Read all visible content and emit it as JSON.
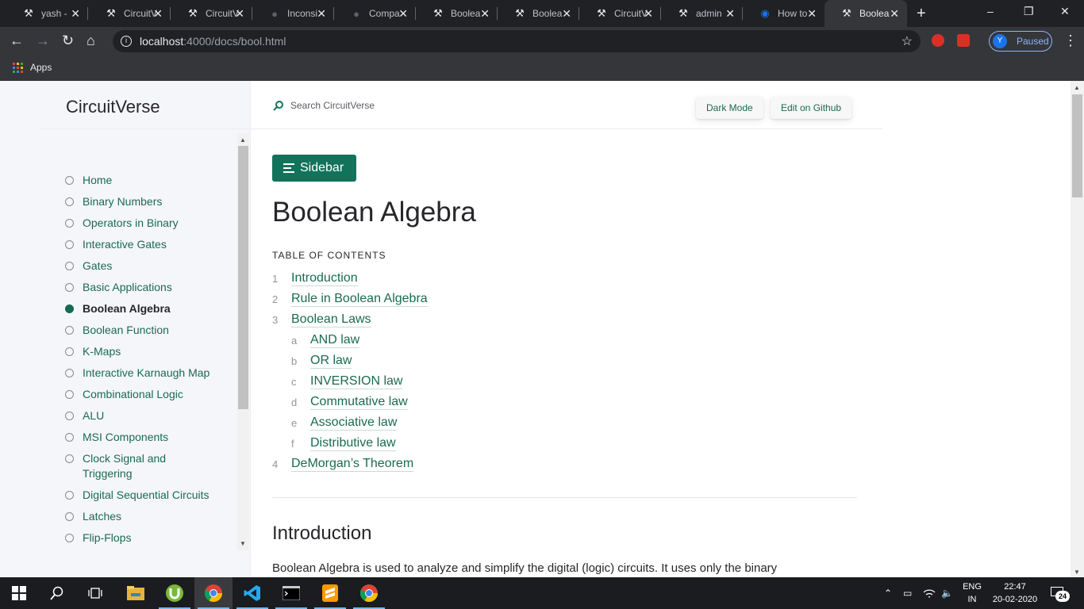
{
  "browser": {
    "tabs": [
      {
        "label": "yash - ",
        "icon": "circuitverse-icon",
        "active": false
      },
      {
        "label": "CircuitV",
        "icon": "circuitverse-icon",
        "active": false
      },
      {
        "label": "CircuitV",
        "icon": "circuitverse-icon",
        "active": false
      },
      {
        "label": "Inconsi",
        "icon": "github-icon",
        "active": false
      },
      {
        "label": "Compa",
        "icon": "github-icon",
        "active": false
      },
      {
        "label": "Boolea",
        "icon": "circuitverse-icon",
        "active": false
      },
      {
        "label": "Boolea",
        "icon": "circuitverse-icon",
        "active": false
      },
      {
        "label": "CircuitV",
        "icon": "circuitverse-icon",
        "active": false
      },
      {
        "label": "admin",
        "icon": "circuitverse-icon",
        "active": false
      },
      {
        "label": "How to",
        "icon": "blue-circle-icon",
        "active": false
      },
      {
        "label": "Boolea",
        "icon": "circuitverse-icon",
        "active": true
      }
    ],
    "url_host": "localhost",
    "url_path": ":4000/docs/bool.html",
    "profile_initial": "Y",
    "profile_status": "Paused",
    "bookmarks": {
      "apps_label": "Apps"
    }
  },
  "sidebar": {
    "brand": "CircuitVerse",
    "items": [
      {
        "label": "Home",
        "active": false
      },
      {
        "label": "Binary Numbers",
        "active": false
      },
      {
        "label": "Operators in Binary",
        "active": false
      },
      {
        "label": "Interactive Gates",
        "active": false
      },
      {
        "label": "Gates",
        "active": false
      },
      {
        "label": "Basic Applications",
        "active": false
      },
      {
        "label": "Boolean Algebra",
        "active": true
      },
      {
        "label": "Boolean Function",
        "active": false
      },
      {
        "label": "K-Maps",
        "active": false
      },
      {
        "label": "Interactive Karnaugh Map",
        "active": false
      },
      {
        "label": "Combinational Logic",
        "active": false
      },
      {
        "label": "ALU",
        "active": false
      },
      {
        "label": "MSI Components",
        "active": false
      },
      {
        "label": "Clock Signal and Triggering",
        "active": false
      },
      {
        "label": "Digital Sequential Circuits",
        "active": false
      },
      {
        "label": "Latches",
        "active": false
      },
      {
        "label": "Flip-Flops",
        "active": false
      }
    ]
  },
  "header": {
    "search_placeholder": "Search CircuitVerse",
    "dark_mode": "Dark Mode",
    "edit_github": "Edit on Github"
  },
  "main": {
    "sidebar_button": "Sidebar",
    "title": "Boolean Algebra",
    "toc_heading": "TABLE OF CONTENTS",
    "toc": [
      {
        "num": "1",
        "label": "Introduction",
        "level": 0
      },
      {
        "num": "2",
        "label": "Rule in Boolean Algebra",
        "level": 0
      },
      {
        "num": "3",
        "label": "Boolean Laws",
        "level": 0
      },
      {
        "num": "a",
        "label": "AND law",
        "level": 1
      },
      {
        "num": "b",
        "label": "OR law",
        "level": 1
      },
      {
        "num": "c",
        "label": "INVERSION law",
        "level": 1
      },
      {
        "num": "d",
        "label": "Commutative law",
        "level": 1
      },
      {
        "num": "e",
        "label": "Associative law",
        "level": 1
      },
      {
        "num": "f",
        "label": "Distributive law",
        "level": 1
      },
      {
        "num": "4",
        "label": "DeMorgan’s Theorem",
        "level": 0
      }
    ],
    "section_heading": "Introduction",
    "section_text": "Boolean Algebra is used to analyze and simplify the digital (logic) circuits. It uses only the binary"
  },
  "taskbar": {
    "apps": [
      "start-icon",
      "search-icon",
      "task-view-icon",
      "file-explorer-icon",
      "utorrent-icon",
      "chrome-icon",
      "vscode-icon",
      "terminal-icon",
      "sublime-icon",
      "chrome-icon"
    ],
    "lang_line1": "ENG",
    "lang_line2": "IN",
    "time": "22:47",
    "date": "20-02-2020",
    "notifications": "24"
  },
  "colors": {
    "accent": "#13735a",
    "link": "#1a6b4f",
    "sidebar_bg": "#f5f6fa",
    "chrome_dark": "#202124"
  }
}
